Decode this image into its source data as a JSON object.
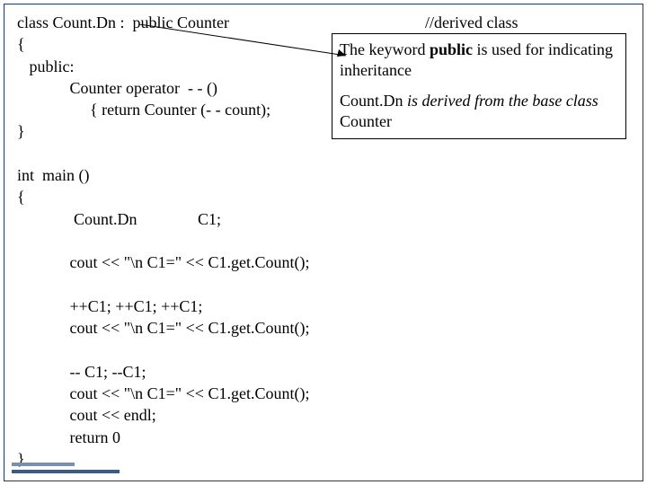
{
  "code": {
    "l1a": "class Count.Dn :  public Counter",
    "l1b": "//derived class",
    "l2": "{",
    "l3": "   public:",
    "l4": "             Counter operator  - - ()",
    "l5": "                  { return Counter (- - count);",
    "l6": "}",
    "l7": "",
    "l8": "int  main ()",
    "l9": "{",
    "l10": "              Count.Dn               C1;",
    "l11": "",
    "l12": "             cout << \"\\n C1=\" << C1.get.Count();",
    "l13": "",
    "l14": "             ++C1; ++C1; ++C1;",
    "l15": "             cout << \"\\n C1=\" << C1.get.Count();",
    "l16": "",
    "l17": "             -- C1; --C1;",
    "l18": "             cout << \"\\n C1=\" << C1.get.Count();",
    "l19": "             cout << endl;",
    "l20": "             return 0",
    "l21": "}"
  },
  "callout": {
    "p1a": "The keyword ",
    "p1b": "public",
    "p1c": " is used for indicating inheritance",
    "p2a": "Count.Dn ",
    "p2b": "is derived from the base class ",
    "p2c": "Counter"
  }
}
